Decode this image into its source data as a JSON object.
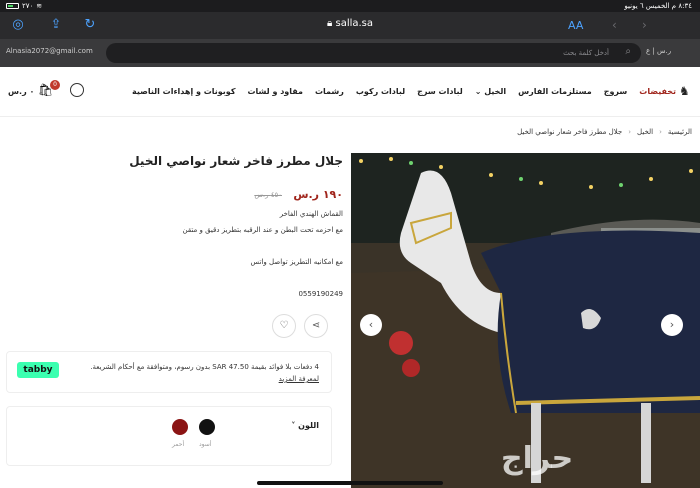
{
  "status": {
    "time_date": "٨:٣٤ م  الخميس ٦ يونيو",
    "battery": "٢٧٠"
  },
  "browser": {
    "url": "salla.sa",
    "aa_label": "AA",
    "email": "Alnasia2072@gmail.com",
    "search_placeholder": "أدخل كلمة بحث",
    "lang": "ر.س | ع"
  },
  "nav": {
    "items": [
      "تخفيضات",
      "سروج",
      "مستلزمات الفارس",
      "الخيل",
      "لبادات سرج",
      "لبادات ركوب",
      "رشمات",
      "مقاود و لشات",
      "كوبونات و إهداءات الناصية"
    ],
    "cart_total": "٠ ر.س",
    "cart_count": "0"
  },
  "breadcrumb": {
    "home": "الرئيسية",
    "category": "الخيل",
    "current": "جلال مطرز فاخر شعار نواصي الخيل"
  },
  "product": {
    "title": "جلال مطرز فاخر شعار نواصي الخيل",
    "price": "١٩٠ ر.س",
    "old_price": "٤٥٠ ر.س",
    "desc1": "القماش الهندي الفاخر",
    "desc2": "مع احزمه تحت البطن و عند الرقبه بتطريز دقيق و متقن",
    "desc3": "مع امكانيه التطريز تواصل واتس",
    "phone": "0559190249",
    "watermark": "حراج"
  },
  "tabby": {
    "logo": "tabby",
    "text": "4 دفعات بلا فوائد بقيمة SAR 47.50 بدون رسوم، ومتوافقة مع أحكام الشريعة.",
    "link": "لمعرفة المزيد"
  },
  "options": {
    "color_label": "اللون",
    "colors": [
      {
        "name": "أسود",
        "hex": "#111111"
      },
      {
        "name": "أحمر",
        "hex": "#8b1414"
      }
    ]
  },
  "colors": {
    "accent": "#a0251c",
    "browser_blue": "#4da3ff"
  }
}
